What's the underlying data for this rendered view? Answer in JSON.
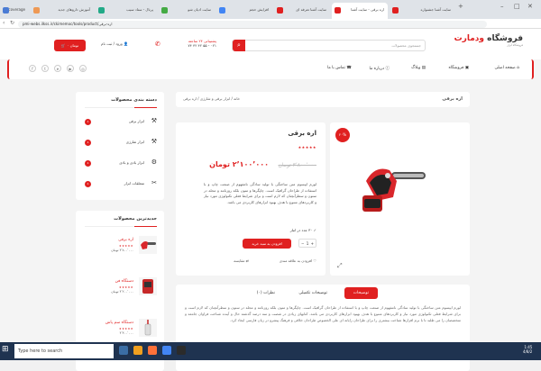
{
  "browser": {
    "tabs": [
      {
        "label": "ercoverage",
        "color": "#4a7bd4"
      },
      {
        "label": "آموزش داروهای جدید",
        "color": "#e95"
      },
      {
        "label": "پرتال - ستاد سیب",
        "color": "#2a8"
      },
      {
        "label": "سایت ادیان شو",
        "color": "#4a4"
      },
      {
        "label": "افزایش حجم",
        "color": "#4285f4"
      },
      {
        "label": "سایت آشنا تعرفه ای",
        "color": "#e02020"
      },
      {
        "label": "اره برقی - سایت آشنا",
        "color": "#e02020"
      },
      {
        "label": "سایت آشنا جشنواره",
        "color": "#e02020"
      }
    ],
    "url": "pmi-webs.ilkss.ir/ckimemoc/tools/product/اره-برقی"
  },
  "header": {
    "logo_main": "فروشگاه",
    "logo_accent": "ودمارت",
    "logo_sub": "فروشگاه ابزار",
    "search_placeholder": "جستجوی محصولات",
    "search_icon": "search-icon",
    "support_title": "پشتیبانی ۲۴ ساعته",
    "support_phone": "۰۲۱ - ۵۵ ۴۲ ۴۲ ۷۴",
    "login_label": "ورود / ثبت نام",
    "cart_label": "۰ تومان"
  },
  "nav": {
    "items": [
      "صفحه اصلی",
      "فروشگاه",
      "وبلاگ",
      "درباره ما",
      "تماس با ما"
    ],
    "social": [
      "facebook-icon",
      "twitter-icon",
      "telegram-icon",
      "youtube-icon",
      "instagram-icon"
    ]
  },
  "page": {
    "title": "اره برقی",
    "breadcrumb": "خانه / ابزار برقی و شارژی / اره برقی"
  },
  "product": {
    "discount": "۲۰%",
    "name": "اره برقی",
    "stars": "★★★★★",
    "old_price": "۳٬۸۰۰٬۰۰۰ تومان",
    "new_price": "۲٬۱۰۰٬۰۰۰ تومان",
    "description": "لورم ایپسوم متن ساختگی با تولید سادگی نامفهوم از صنعت چاپ و با استفاده از طراحان گرافیک است. چاپگرها و متون بلکه روزنامه و مجله در ستون و سطرآنچنان که لازم است و برای شرایط فعلی تکنولوژی مورد نیاز و کاربردهای متنوع با هدف بهبود ابزارهای کاربردی می باشد.",
    "stock": "۳۰ عدد در انبار",
    "quantity": "1",
    "add_to_cart": "افزودن به سبد خرید",
    "compare": "مقایسه",
    "wishlist": "افزودن به علاقه مندی"
  },
  "sidebar": {
    "categories_title": "دسته بندی محصولات",
    "categories": [
      {
        "label": "ابزار برقی",
        "count": "1",
        "icon": "drill-icon"
      },
      {
        "label": "ابزار شارژی",
        "count": "1",
        "icon": "cordless-drill-icon"
      },
      {
        "label": "ابزار بادی و بادی",
        "count": "1",
        "icon": "compressor-icon"
      },
      {
        "label": "متعلقات ابزار",
        "count": "1",
        "icon": "wrench-icon"
      }
    ],
    "new_title": "جدیدترین محصولات",
    "new_products": [
      {
        "name": "اره برقی",
        "stars": "★★★★★",
        "price": "۳٬۸۰۰٬۰۰۰ تومان"
      },
      {
        "name": "دستگاه فن",
        "stars": "★★★★★",
        "price": "۴٬۲۰۰٬۰۰۰ تومان"
      },
      {
        "name": "دستگاه سم پاش",
        "stars": "★★★★★",
        "price": "۴٬۳۰۰٬۰۰۰"
      }
    ]
  },
  "tabs": {
    "items": [
      "توضیحات",
      "توضیحات تکمیلی",
      "نظرات (۰)"
    ],
    "content": "لورم ایپسوم متن ساختگی با تولید سادگی نامفهوم از صنعت چاپ و با استفاده از طراحان گرافیک است. چاپگرها و متون بلکه روزنامه و مجله در ستون و سطرآنچنان که لازم است و برای شرایط فعلی تکنولوژی مورد نیاز و کاربردهای متنوع با هدف بهبود ابزارهای کاربردی می باشد. کتابهای زیادی در شصت و سه درصد گذشته حال و آینده شناخت فراوان جامعه و متخصصان را می طلبد تا با نرم افزارها شناخت بیشتری را برای طراحان رایانه ای علی الخصوص طراحان خلاقی و فرهنگ پیشرو در زبان فارسی ایجاد کرد."
  },
  "taskbar": {
    "search": "Type here to search",
    "time": "1:45",
    "date": "4/8/2"
  },
  "colors": {
    "accent": "#e02020"
  }
}
